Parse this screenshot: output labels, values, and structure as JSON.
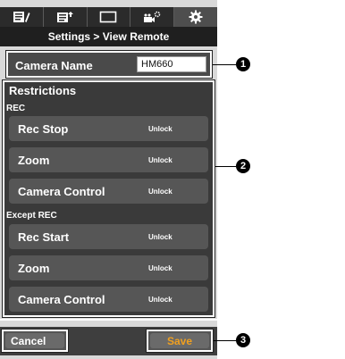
{
  "tabs": [
    {
      "icon": "edit-list-icon"
    },
    {
      "icon": "list-upload-icon"
    },
    {
      "icon": "view-frame-icon"
    },
    {
      "icon": "camera-settings-icon"
    },
    {
      "icon": "gear-icon",
      "active": true
    }
  ],
  "header": {
    "breadcrumb": "Settings > View Remote"
  },
  "camera_name": {
    "label": "Camera Name",
    "value": "HM660"
  },
  "restrictions": {
    "title": "Restrictions",
    "rec_label": "REC",
    "rec_items": [
      {
        "label": "Rec Stop",
        "value": "Unlock"
      },
      {
        "label": "Zoom",
        "value": "Unlock"
      },
      {
        "label": "Camera Control",
        "value": "Unlock"
      }
    ],
    "except_label": "Except REC",
    "except_items": [
      {
        "label": "Rec Start",
        "value": "Unlock"
      },
      {
        "label": "Zoom",
        "value": "Unlock"
      },
      {
        "label": "Camera Control",
        "value": "Unlock"
      }
    ]
  },
  "footer": {
    "cancel": "Cancel",
    "save": "Save"
  },
  "callouts": [
    "1",
    "2",
    "3"
  ],
  "colors": {
    "save_text": "#f0a020",
    "panel": "#3a3a3a"
  }
}
